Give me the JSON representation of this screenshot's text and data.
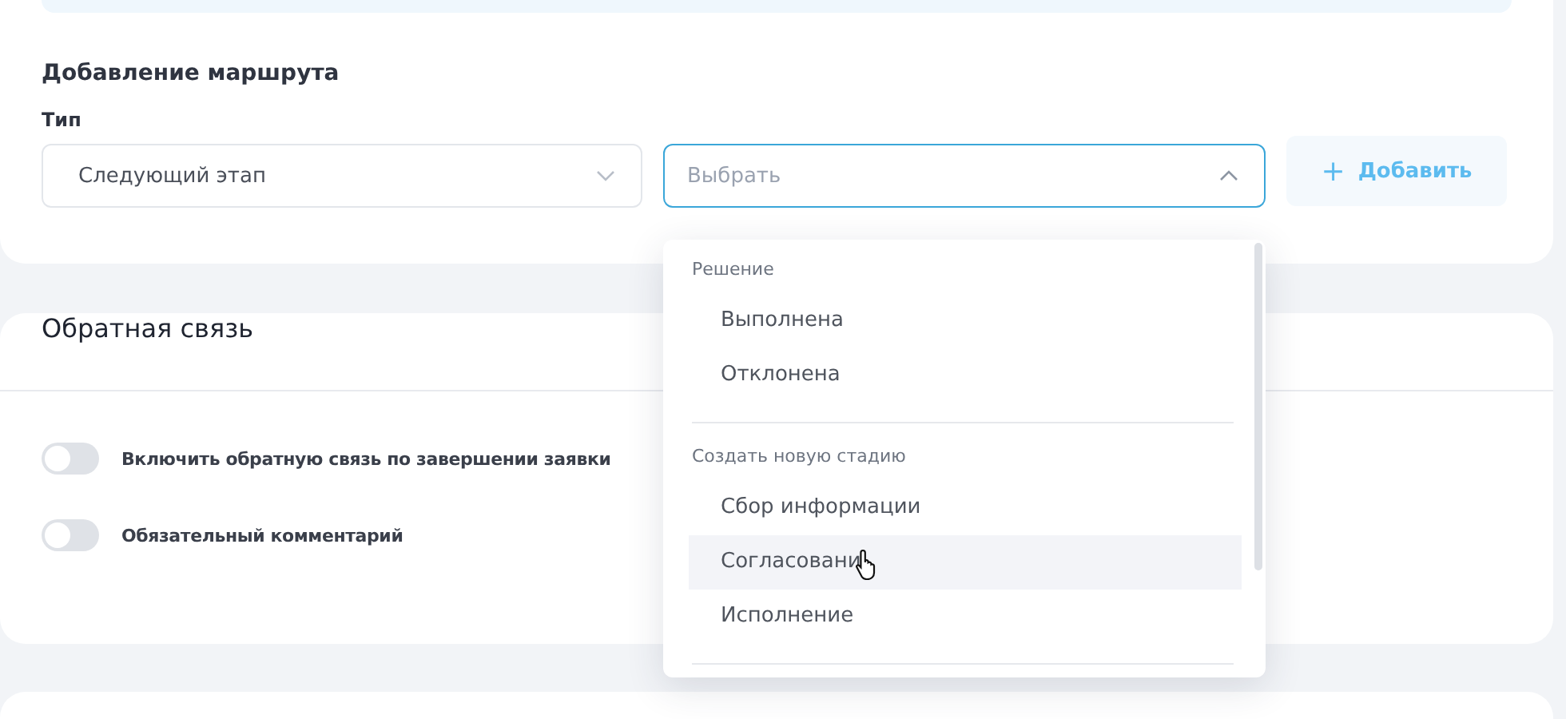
{
  "route_section": {
    "title": "Добавление маршрута",
    "type_label": "Тип",
    "type_select": {
      "value": "Следующий этап"
    },
    "target_select": {
      "placeholder": "Выбрать",
      "open": true
    },
    "add_button": {
      "icon": "+",
      "label": "Добавить"
    }
  },
  "dropdown": {
    "groups": [
      {
        "header": "Решение",
        "items": [
          {
            "label": "Выполнена",
            "hovered": false
          },
          {
            "label": "Отклонена",
            "hovered": false
          }
        ]
      },
      {
        "header": "Создать новую стадию",
        "items": [
          {
            "label": "Сбор информации",
            "hovered": false
          },
          {
            "label": "Согласовани",
            "hovered": true
          },
          {
            "label": "Исполнение",
            "hovered": false
          }
        ]
      }
    ]
  },
  "feedback_section": {
    "title": "Обратная связь",
    "toggles": [
      {
        "label": "Включить обратную связь по завершении заявки",
        "on": false
      },
      {
        "label": "Обязательный комментарий",
        "on": false
      }
    ]
  }
}
